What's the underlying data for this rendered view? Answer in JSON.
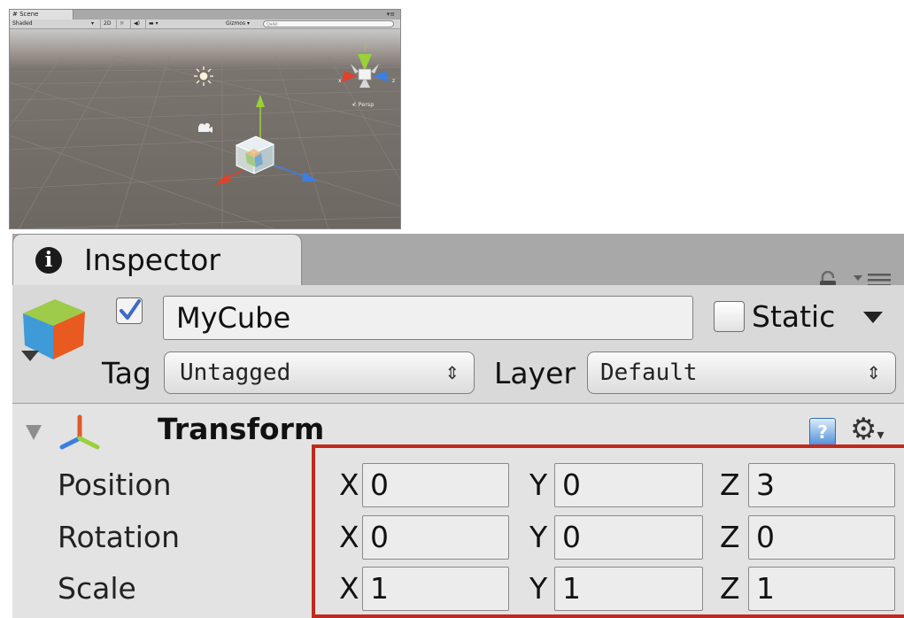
{
  "scene": {
    "tab_label": "Scene",
    "toolbar": {
      "draw_mode": "Shaded",
      "mode_2d": "2D",
      "gizmos_label": "Gizmos",
      "search_placeholder": "Q▾All"
    },
    "persp_label": "Persp",
    "axis_x": "x",
    "axis_y": "y",
    "axis_z": "z"
  },
  "inspector": {
    "tab_title": "Inspector",
    "gameobject": {
      "active": true,
      "name": "MyCube",
      "static_label": "Static",
      "static": false,
      "tag_label": "Tag",
      "tag_value": "Untagged",
      "layer_label": "Layer",
      "layer_value": "Default"
    },
    "transform": {
      "title": "Transform",
      "rows": [
        {
          "label": "Position",
          "x": "0",
          "y": "0",
          "z": "3"
        },
        {
          "label": "Rotation",
          "x": "0",
          "y": "0",
          "z": "0"
        },
        {
          "label": "Scale",
          "x": "1",
          "y": "1",
          "z": "1"
        }
      ],
      "axis_labels": {
        "x": "X",
        "y": "Y",
        "z": "Z"
      }
    }
  },
  "colors": {
    "highlight": "#c2281c",
    "x_axis": "#e0412b",
    "y_axis": "#9ad03a",
    "z_axis": "#3b7fe0",
    "checkbox_check": "#3e6ac8"
  }
}
